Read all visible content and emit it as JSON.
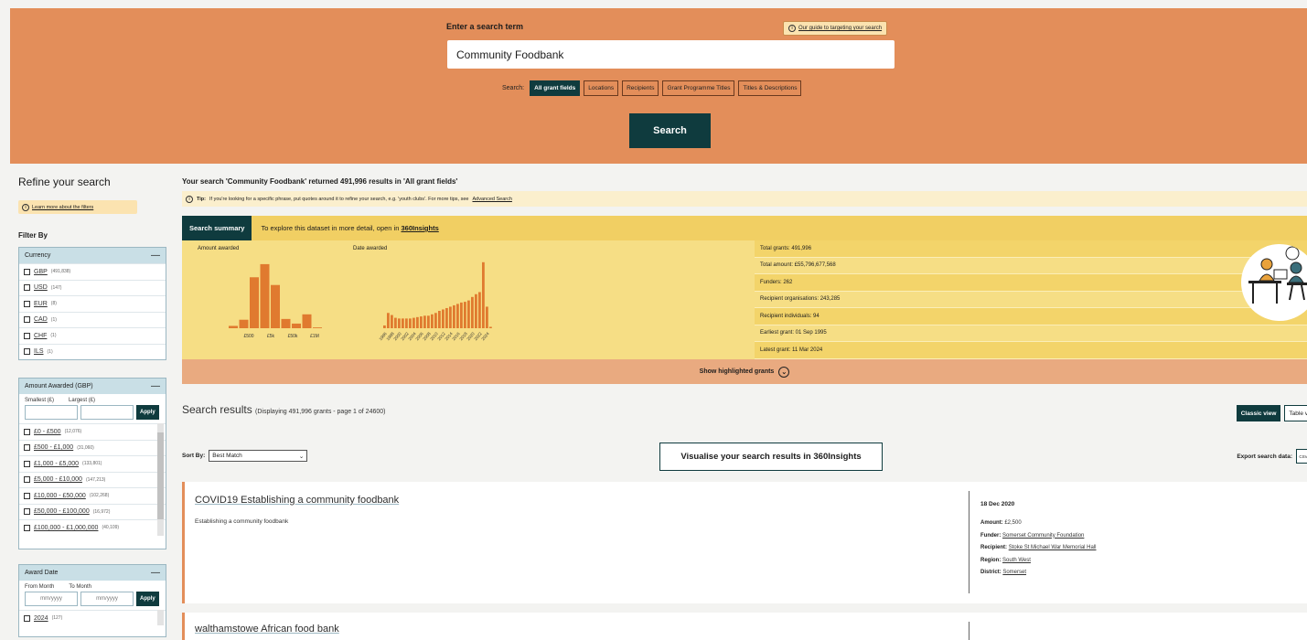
{
  "hero": {
    "label": "Enter a search term",
    "guide_link": "Our guide to targeting your search",
    "search_value": "Community Foodbank",
    "scope_label": "Search:",
    "scopes": [
      "All grant fields",
      "Locations",
      "Recipients",
      "Grant Programme Titles",
      "Titles & Descriptions"
    ],
    "search_button": "Search"
  },
  "sidebar": {
    "title": "Refine your search",
    "help_link": "Learn more about the filters",
    "filter_by": "Filter By",
    "currency": {
      "title": "Currency",
      "options": [
        {
          "name": "GBP",
          "count": "(491,838)"
        },
        {
          "name": "USD",
          "count": "(147)"
        },
        {
          "name": "EUR",
          "count": "(8)"
        },
        {
          "name": "CAD",
          "count": "(1)"
        },
        {
          "name": "CHF",
          "count": "(1)"
        },
        {
          "name": "ILS",
          "count": "(1)"
        }
      ]
    },
    "amount": {
      "title": "Amount Awarded (GBP)",
      "smallest_label": "Smallest (£)",
      "largest_label": "Largest (£)",
      "apply": "Apply",
      "options": [
        {
          "name": "£0 - £500",
          "count": "(12,076)"
        },
        {
          "name": "£500 - £1,000",
          "count": "(31,060)"
        },
        {
          "name": "£1,000 - £5,000",
          "count": "(133,801)"
        },
        {
          "name": "£5,000 - £10,000",
          "count": "(147,213)"
        },
        {
          "name": "£10,000 - £50,000",
          "count": "(102,268)"
        },
        {
          "name": "£50,000 - £100,000",
          "count": "(16,972)"
        },
        {
          "name": "£100,000 - £1,000,000",
          "count": "(40,109)"
        }
      ]
    },
    "award_date": {
      "title": "Award Date",
      "from_label": "From Month",
      "to_label": "To Month",
      "placeholder": "mm/yyyy",
      "apply": "Apply",
      "options": [
        {
          "name": "2024",
          "count": "(127)"
        }
      ]
    }
  },
  "main": {
    "headline": "Your search 'Community Foodbank' returned 491,996 results in 'All grant fields'",
    "tip_label": "Tip:",
    "tip_text": "If you're looking for a specific phrase, put quotes around it to refine your search, e.g. 'youth clubs'. For more tips, see",
    "tip_link": "Advanced Search",
    "summary_tab": "Search summary",
    "explore_text": "To explore this dataset in more detail, open in",
    "explore_link": "360Insights",
    "stats": [
      "Total grants: 491,996",
      "Total amount: £55,796,677,568",
      "Funders: 262",
      "Recipient organisations: 243,285",
      "Recipient individuals: 94",
      "Earliest grant: 01 Sep 1995",
      "Latest grant: 11 Mar 2024"
    ],
    "highlight_button": "Show highlighted grants",
    "results_title": "Search results",
    "results_sub": "(Displaying 491,996 grants - page 1 of 24600)",
    "view_classic": "Classic view",
    "view_table": "Table v",
    "sort_label": "Sort By:",
    "sort_value": "Best Match",
    "visualise_button": "Visualise your search results in 360Insights",
    "export_label": "Export search data:",
    "export_format": "CSV"
  },
  "chart_data": [
    {
      "type": "bar",
      "title": "Amount awarded",
      "categories": [
        "b1",
        "b2",
        "b3",
        "b4",
        "b5",
        "b6",
        "b7",
        "b8",
        "b9"
      ],
      "tick_labels": [
        "£500",
        "£5k",
        "£50k",
        "£1M"
      ],
      "values": [
        3,
        11,
        66,
        83,
        56,
        12,
        6,
        18,
        1
      ],
      "ylim": [
        0,
        90
      ]
    },
    {
      "type": "bar",
      "title": "Date awarded",
      "categories": [
        "1995",
        "1996",
        "1997",
        "1998",
        "1999",
        "2000",
        "2001",
        "2002",
        "2003",
        "2004",
        "2005",
        "2006",
        "2007",
        "2008",
        "2009",
        "2010",
        "2011",
        "2012",
        "2013",
        "2014",
        "2015",
        "2016",
        "2017",
        "2018",
        "2019",
        "2020",
        "2021",
        "2022",
        "2023",
        "2024"
      ],
      "tick_labels": [
        "1996",
        "1998",
        "2000",
        "2002",
        "2004",
        "2006",
        "2008",
        "2010",
        "2012",
        "2014",
        "2016",
        "2018",
        "2020",
        "2022",
        "2024"
      ],
      "values": [
        4,
        22,
        19,
        15,
        14,
        14,
        14,
        14,
        15,
        16,
        17,
        18,
        18,
        20,
        22,
        25,
        27,
        29,
        31,
        33,
        35,
        37,
        38,
        40,
        45,
        49,
        52,
        95,
        31,
        2
      ],
      "ylim": [
        0,
        100
      ]
    }
  ],
  "grants": [
    {
      "title": "COVID19 Establishing a community foodbank",
      "description": "Establishing a community foodbank",
      "date": "18 Dec 2020",
      "amount_label": "Amount:",
      "amount": "£2,500",
      "funder_label": "Funder:",
      "funder": "Somerset Community Foundation",
      "recipient_label": "Recipient:",
      "recipient": "Stoke St Michael War Memorial Hall",
      "region_label": "Region:",
      "region": "South West",
      "district_label": "District:",
      "district": "Somerset"
    },
    {
      "title": "walthamstowe African food bank"
    }
  ],
  "colors": {
    "hero": "#e38e5a",
    "accent_dark": "#0f3b3e",
    "summary_yellow": "#f6de85",
    "bar_orange": "#e07a2f"
  }
}
